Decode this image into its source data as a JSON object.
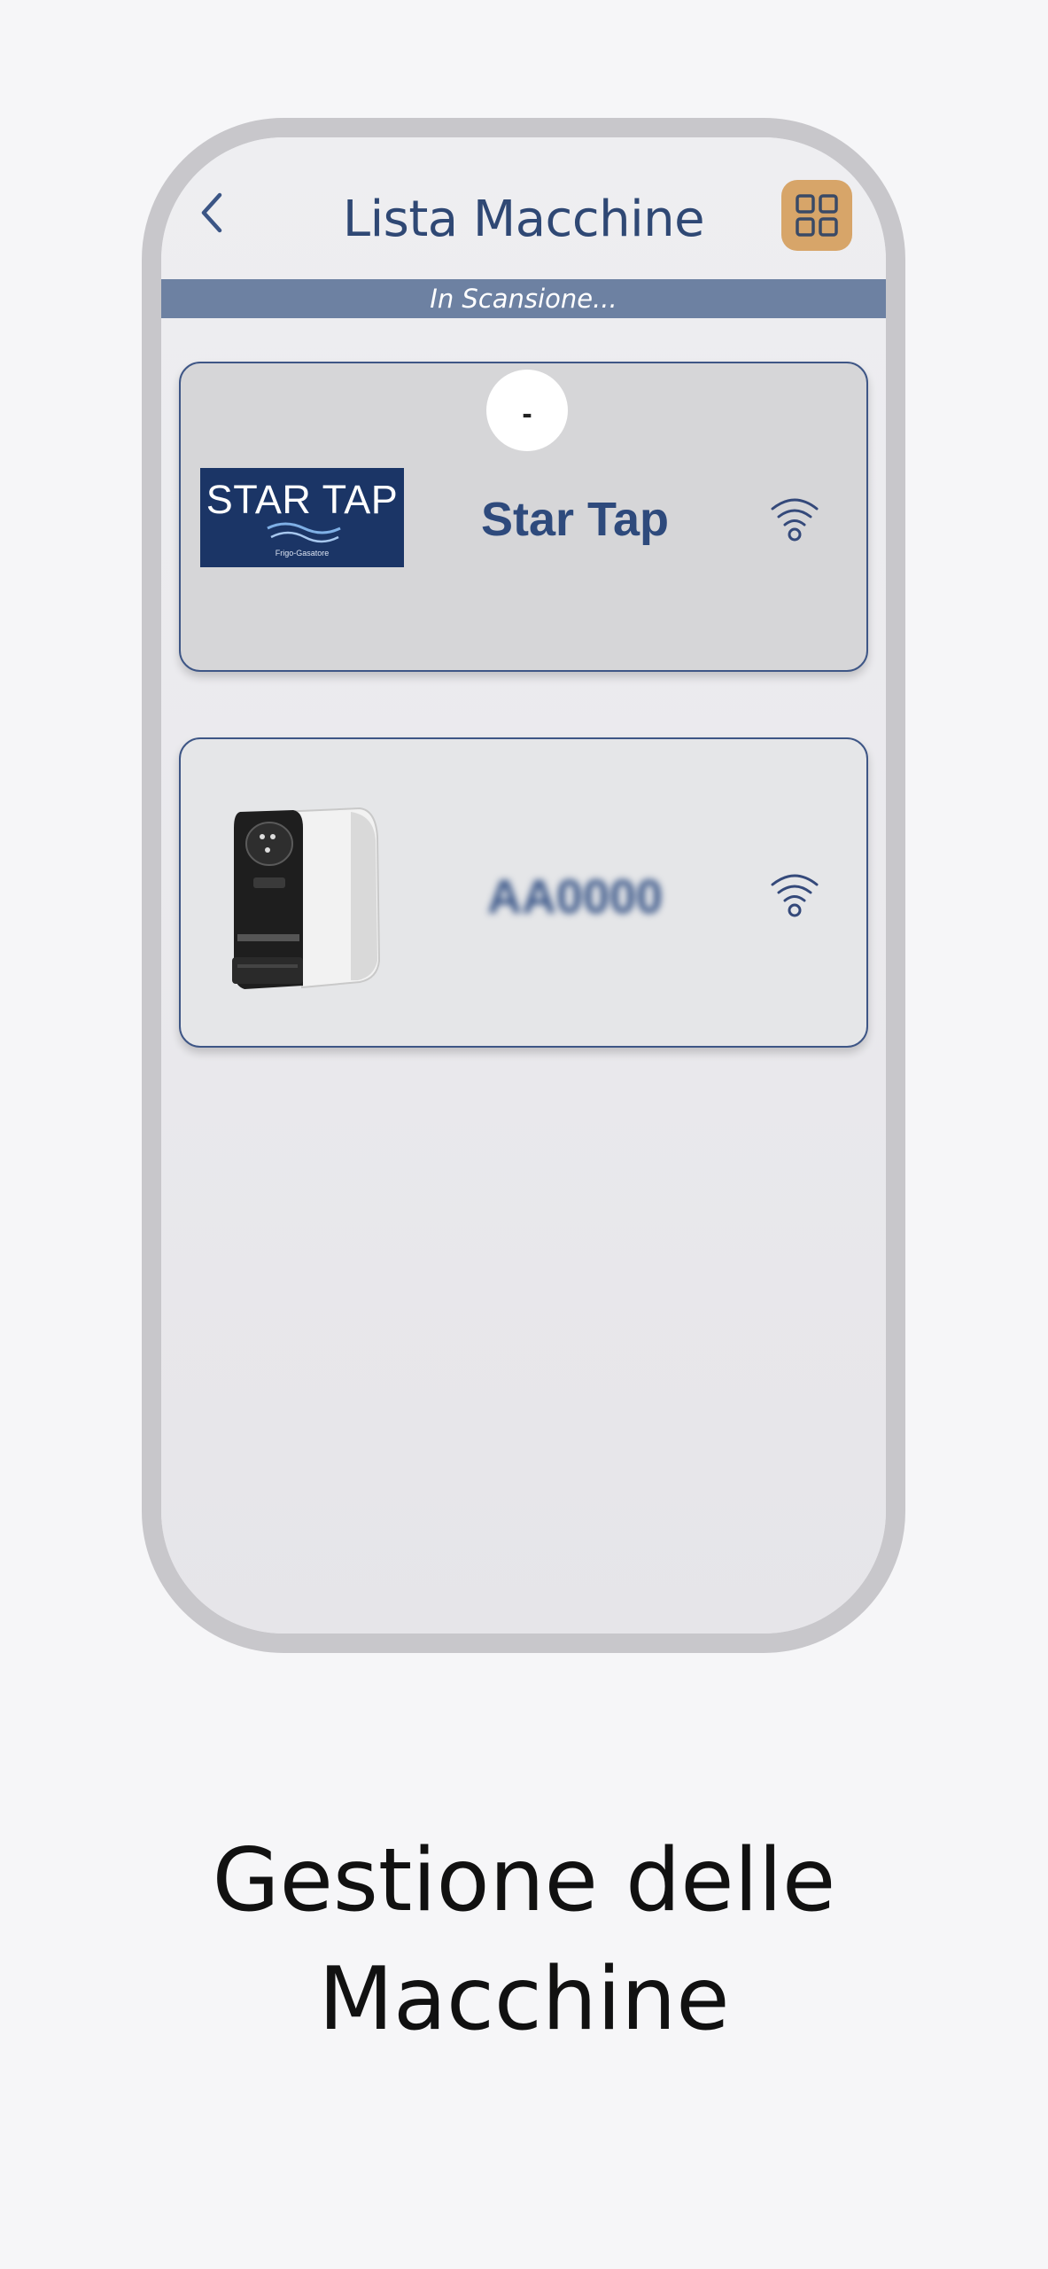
{
  "header": {
    "title": "Lista Macchine",
    "back_icon": "chevron-left-icon",
    "grid_icon": "grid-icon"
  },
  "scan_status": "In Scansione...",
  "machines": [
    {
      "name": "Star Tap",
      "status_indicator": "-",
      "logo": {
        "text": "STAR TAP",
        "tagline": "Frigo-Gasatore"
      },
      "icon": "wifi-icon"
    },
    {
      "name": "AA0000",
      "image": "coffee-machine-image",
      "icon": "wifi-icon"
    }
  ],
  "caption": {
    "line1": "Gestione delle",
    "line2": "Macchine"
  },
  "colors": {
    "primary": "#2f4874",
    "scan_bar": "#6d81a2",
    "grid_button": "#d7a569",
    "phone_frame": "#c8c7cb"
  }
}
